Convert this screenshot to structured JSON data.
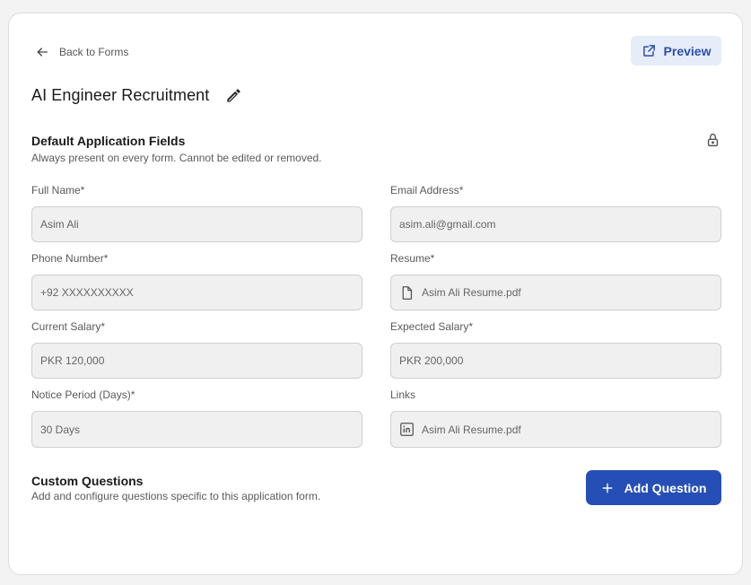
{
  "header": {
    "back_label": "Back to Forms",
    "preview_label": "Preview",
    "form_title": "AI Engineer Recruitment"
  },
  "default_section": {
    "title": "Default Application Fields",
    "subtitle": "Always present on every form. Cannot be edited or removed."
  },
  "fields": [
    {
      "label": "Full Name*",
      "value": "Asim Ali",
      "icon": ""
    },
    {
      "label": "Email Address*",
      "value": "asim.ali@gmail.com",
      "icon": ""
    },
    {
      "label": "Phone Number*",
      "value": "+92 XXXXXXXXXX",
      "icon": ""
    },
    {
      "label": "Resume*",
      "value": "Asim Ali Resume.pdf",
      "icon": "file-icon"
    },
    {
      "label": "Current Salary*",
      "value": "PKR 120,000",
      "icon": ""
    },
    {
      "label": "Expected Salary*",
      "value": "PKR 200,000",
      "icon": ""
    },
    {
      "label": "Notice Period (Days)*",
      "value": "30 Days",
      "icon": ""
    },
    {
      "label": "Links",
      "value": "Asim Ali Resume.pdf",
      "icon": "linkedin-icon"
    }
  ],
  "custom_section": {
    "title": "Custom Questions",
    "subtitle": "Add and configure questions specific to this application form.",
    "add_label": "Add Question"
  },
  "colors": {
    "accent": "#264fb5",
    "preview_bg": "#e6ecf8",
    "field_bg": "#f0f0f0"
  }
}
